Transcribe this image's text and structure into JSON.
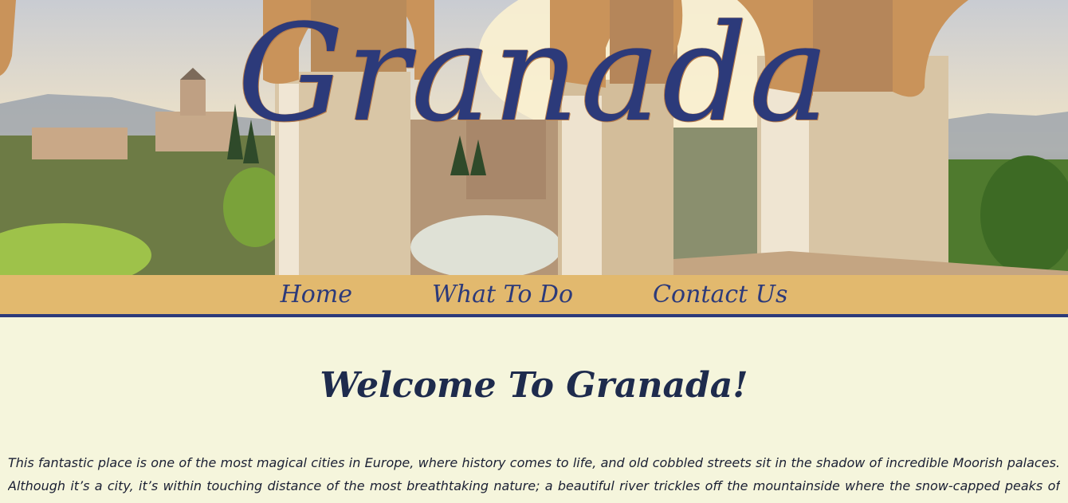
{
  "header": {
    "title": "Granada"
  },
  "nav": {
    "items": [
      {
        "label": "Home"
      },
      {
        "label": "What To Do"
      },
      {
        "label": "Contact Us"
      }
    ]
  },
  "main": {
    "heading": "Welcome To Granada!",
    "intro": "This fantastic place is one of the most magical cities in Europe, where history comes to life, and old cobbled streets sit in the shadow of incredible Moorish palaces. Although it’s a city, it’s within touching distance of the most breathtaking nature; a beautiful river trickles off the mountainside where the snow-capped peaks of the Sierra Nevada look down over the rooftops and the Alhambra stands guard above the old quarter."
  },
  "colors": {
    "accent": "#2c3a7a",
    "nav_background": "#e2b96e",
    "page_background": "#f5f5dc"
  }
}
